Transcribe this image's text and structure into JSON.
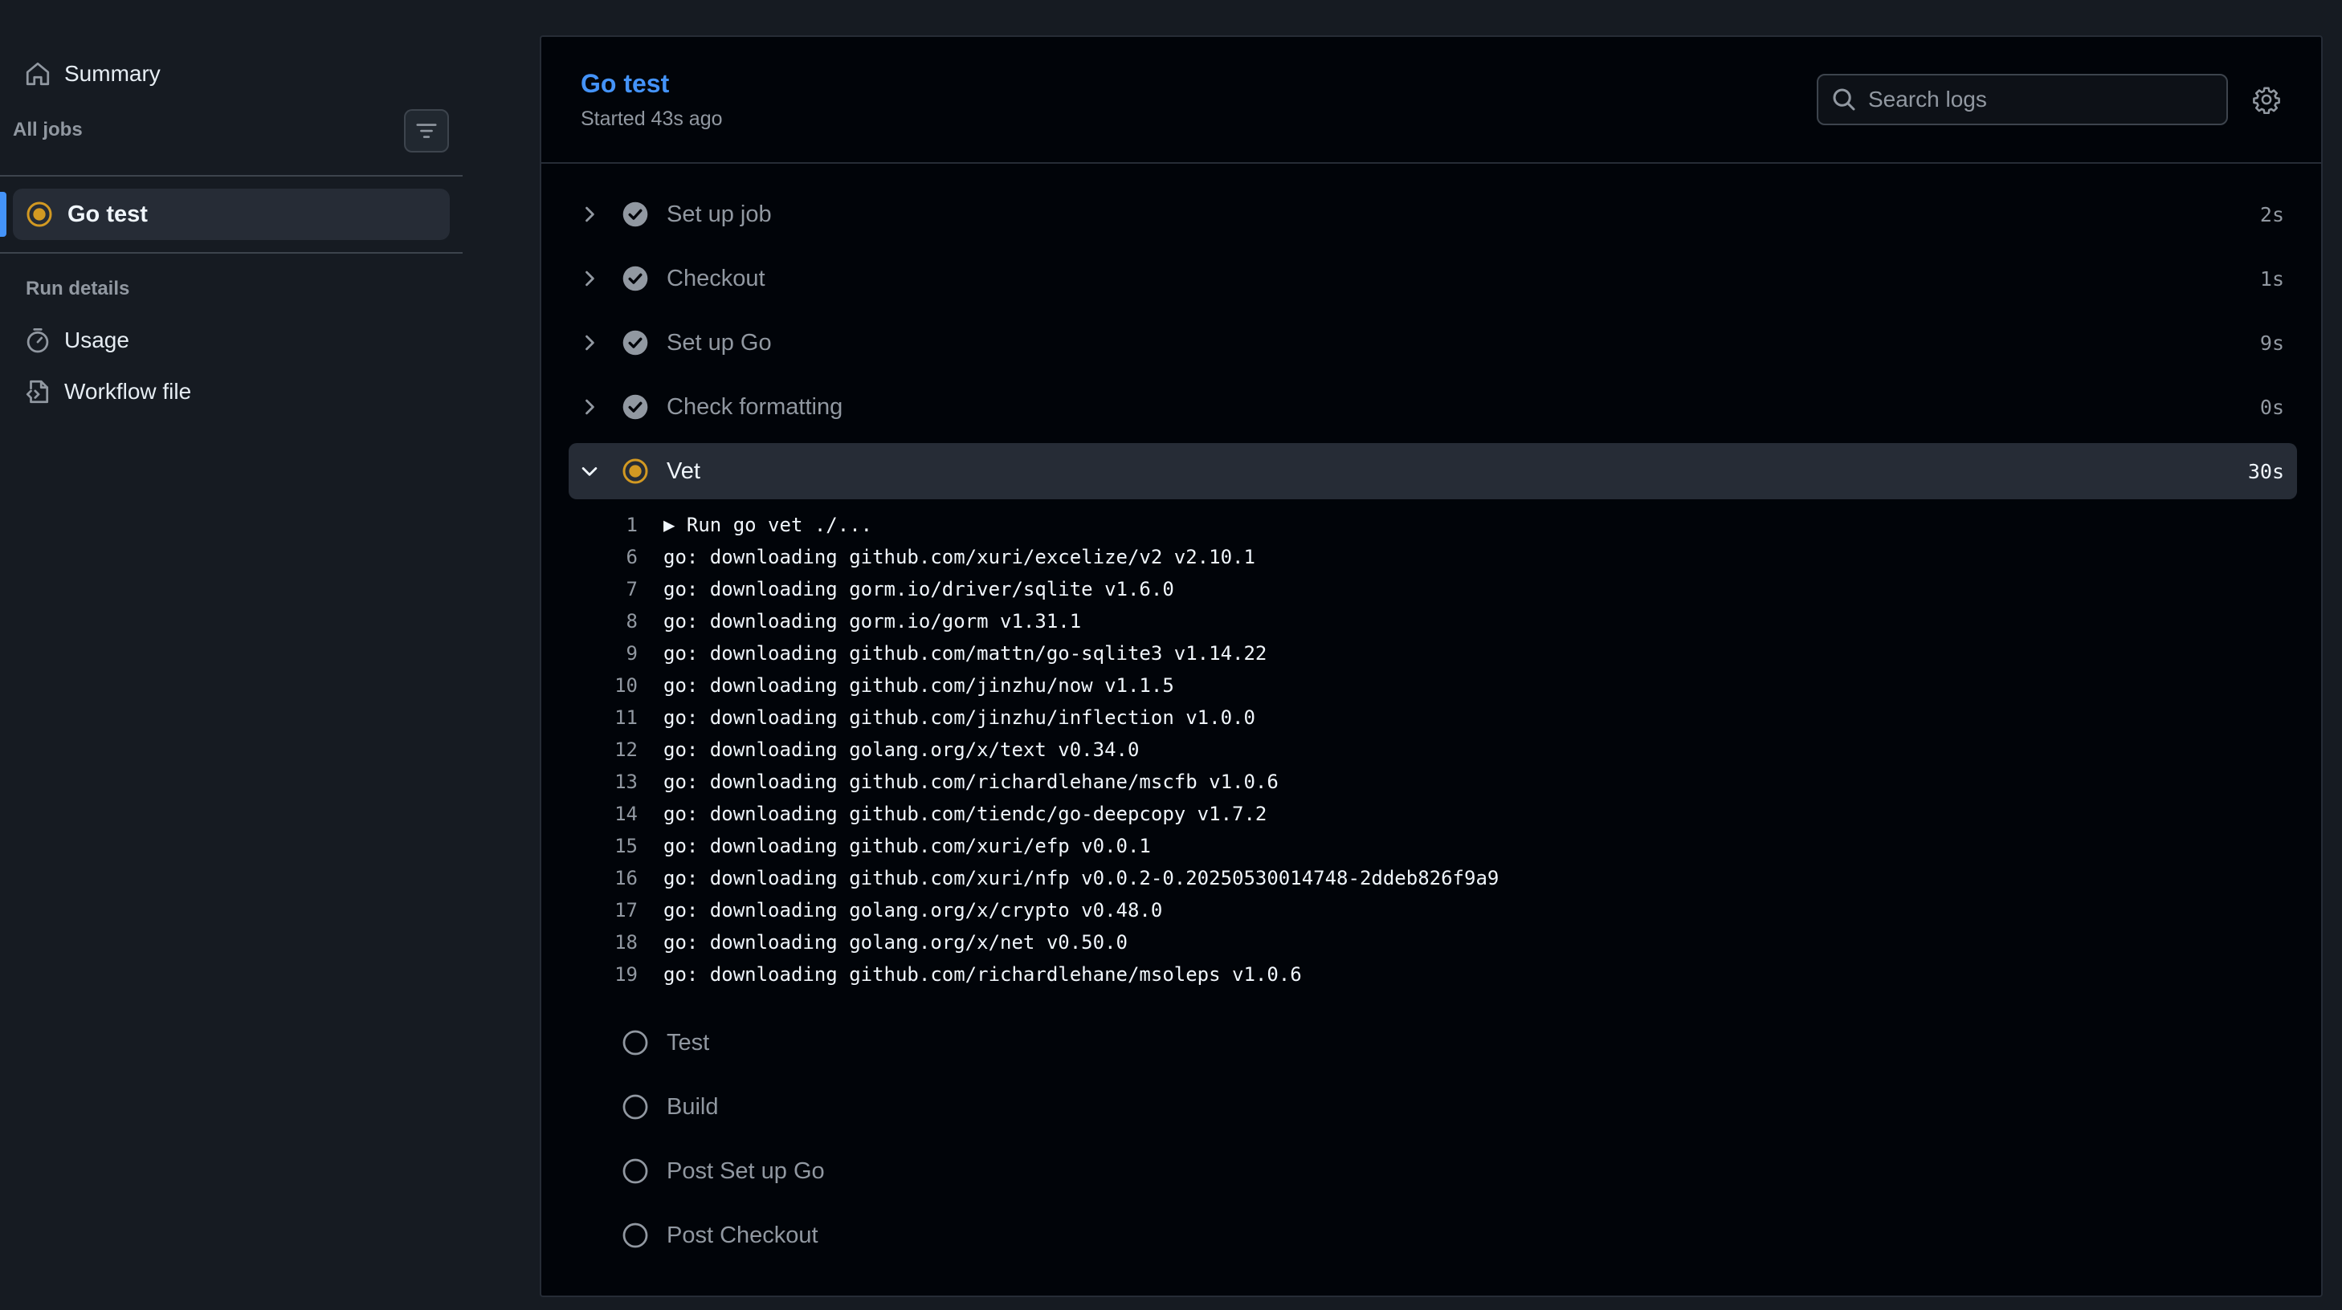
{
  "sidebar": {
    "summary_label": "Summary",
    "all_jobs_label": "All jobs",
    "jobs": [
      {
        "label": "Go test",
        "status": "in-progress"
      }
    ],
    "run_details_label": "Run details",
    "usage_label": "Usage",
    "workflow_file_label": "Workflow file"
  },
  "header": {
    "title": "Go test",
    "started": "Started 43s ago",
    "search_placeholder": "Search logs"
  },
  "steps": [
    {
      "name": "Set up job",
      "duration": "2s",
      "status": "success"
    },
    {
      "name": "Checkout",
      "duration": "1s",
      "status": "success"
    },
    {
      "name": "Set up Go",
      "duration": "9s",
      "status": "success"
    },
    {
      "name": "Check formatting",
      "duration": "0s",
      "status": "success"
    },
    {
      "name": "Vet",
      "duration": "30s",
      "status": "in-progress",
      "expanded": true
    },
    {
      "name": "Test",
      "duration": "",
      "status": "pending"
    },
    {
      "name": "Build",
      "duration": "",
      "status": "pending"
    },
    {
      "name": "Post Set up Go",
      "duration": "",
      "status": "pending"
    },
    {
      "name": "Post Checkout",
      "duration": "",
      "status": "pending"
    }
  ],
  "log": [
    {
      "num": "1",
      "text": "▶ Run go vet ./..."
    },
    {
      "num": "6",
      "text": "go: downloading github.com/xuri/excelize/v2 v2.10.1"
    },
    {
      "num": "7",
      "text": "go: downloading gorm.io/driver/sqlite v1.6.0"
    },
    {
      "num": "8",
      "text": "go: downloading gorm.io/gorm v1.31.1"
    },
    {
      "num": "9",
      "text": "go: downloading github.com/mattn/go-sqlite3 v1.14.22"
    },
    {
      "num": "10",
      "text": "go: downloading github.com/jinzhu/now v1.1.5"
    },
    {
      "num": "11",
      "text": "go: downloading github.com/jinzhu/inflection v1.0.0"
    },
    {
      "num": "12",
      "text": "go: downloading golang.org/x/text v0.34.0"
    },
    {
      "num": "13",
      "text": "go: downloading github.com/richardlehane/mscfb v1.0.6"
    },
    {
      "num": "14",
      "text": "go: downloading github.com/tiendc/go-deepcopy v1.7.2"
    },
    {
      "num": "15",
      "text": "go: downloading github.com/xuri/efp v0.0.1"
    },
    {
      "num": "16",
      "text": "go: downloading github.com/xuri/nfp v0.0.2-0.20250530014748-2ddeb826f9a9"
    },
    {
      "num": "17",
      "text": "go: downloading golang.org/x/crypto v0.48.0"
    },
    {
      "num": "18",
      "text": "go: downloading golang.org/x/net v0.50.0"
    },
    {
      "num": "19",
      "text": "go: downloading github.com/richardlehane/msoleps v1.0.6"
    }
  ],
  "colors": {
    "accent": "#4493f8",
    "in_progress": "#d29922",
    "success_icon": "#9198a1",
    "background": "#161b22",
    "panel": "#010409"
  },
  "icons": {
    "summary": "home-icon",
    "filter": "filter-icon",
    "usage": "stopwatch-icon",
    "workflow_file": "file-code-icon",
    "search": "search-icon",
    "settings": "gear-icon"
  }
}
